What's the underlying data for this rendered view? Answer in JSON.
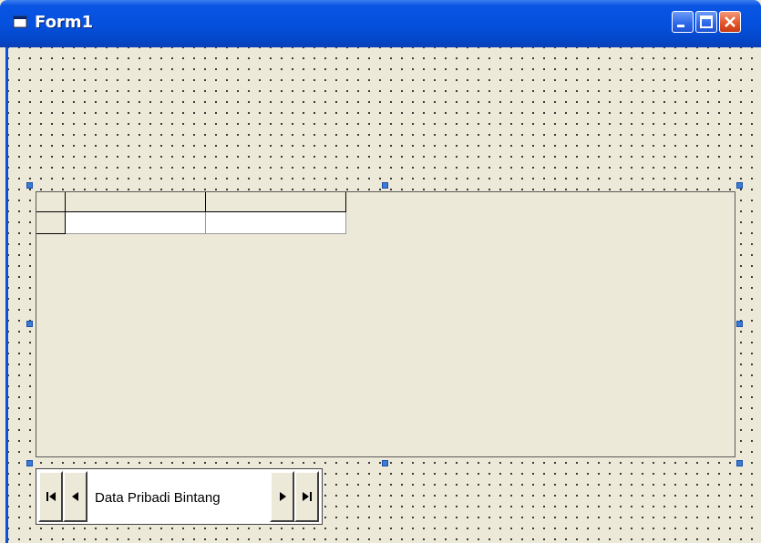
{
  "window": {
    "title": "Form1",
    "buttons": [
      {
        "name": "minimize-button",
        "icon": "minimize-icon"
      },
      {
        "name": "maximize-button",
        "icon": "maximize-icon"
      },
      {
        "name": "close-button",
        "icon": "close-icon"
      }
    ]
  },
  "datagrid": {
    "columns": [
      "",
      ""
    ],
    "rows": [
      [
        "",
        ""
      ]
    ]
  },
  "datacontrol": {
    "caption": "Data Pribadi Bintang",
    "buttons": {
      "first": "first-record-icon",
      "prev": "previous-record-icon",
      "next": "next-record-icon",
      "last": "last-record-icon"
    }
  },
  "colors": {
    "titlebar": "#0551de",
    "form_bg": "#ece9d8",
    "selection_handle": "#3a7bd5",
    "close_button": "#e4572b"
  }
}
